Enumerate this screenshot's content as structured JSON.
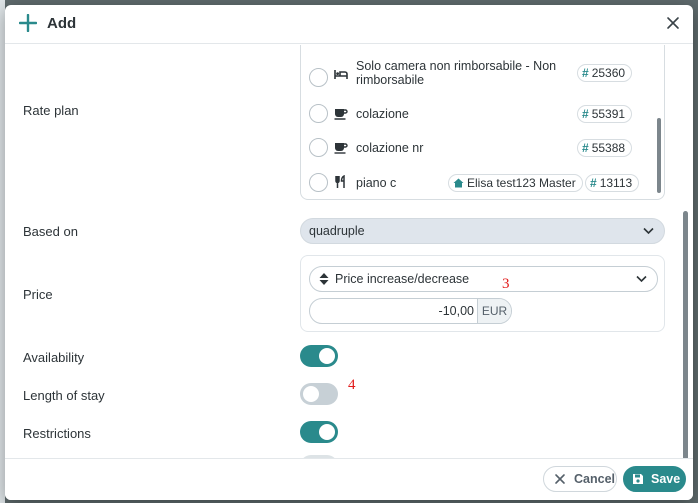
{
  "modal": {
    "title": "Add",
    "close_icon": "close-icon"
  },
  "fields": {
    "rate_plan_label": "Rate plan",
    "based_on_label": "Based on",
    "price_label": "Price",
    "availability_label": "Availability",
    "length_of_stay_label": "Length of stay",
    "restrictions_label": "Restrictions"
  },
  "rate_plans": [
    {
      "name": "Solo camera non rimborsabile - Non rimborsabile",
      "icon": "bed-icon",
      "code": "25360",
      "selected": false
    },
    {
      "name": "colazione",
      "icon": "cup-icon",
      "code": "55391",
      "selected": false
    },
    {
      "name": "colazione nr",
      "icon": "cup-icon",
      "code": "55388",
      "selected": false
    },
    {
      "name": "piano c",
      "icon": "cutlery-icon",
      "property": "Elisa test123 Master",
      "code": "13113",
      "selected": false
    }
  ],
  "based_on": {
    "value": "quadruple"
  },
  "price": {
    "mode": "Price increase/decrease",
    "amount": "-10,00",
    "currency": "EUR"
  },
  "toggles": {
    "availability": true,
    "length_of_stay": false,
    "restrictions": true
  },
  "annotations": {
    "a3": "3",
    "a4": "4"
  },
  "footer": {
    "cancel_label": "Cancel",
    "save_label": "Save"
  },
  "colors": {
    "accent": "#2a8a8c",
    "annotation": "#e21b1b"
  }
}
